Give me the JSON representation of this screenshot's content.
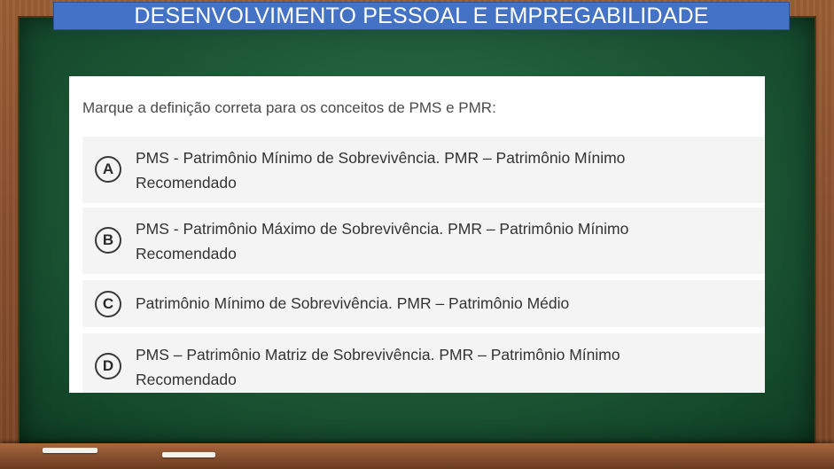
{
  "header": {
    "title": "DESENVOLVIMENTO PESSOAL E EMPREGABILIDADE"
  },
  "question": {
    "prompt": "Marque a definição correta para os conceitos de PMS e PMR:"
  },
  "options": [
    {
      "letter": "A",
      "text": "PMS - Patrimônio Mínimo de Sobrevivência. PMR – Patrimônio Mínimo Recomendado"
    },
    {
      "letter": "B",
      "text": "PMS - Patrimônio Máximo de Sobrevivência. PMR – Patrimônio Mínimo Recomendado"
    },
    {
      "letter": "C",
      "text": "Patrimônio Mínimo de Sobrevivência. PMR – Patrimônio Médio"
    },
    {
      "letter": "D",
      "text": "PMS – Patrimônio Matriz de Sobrevivência. PMR – Patrimônio Mínimo Recomendado"
    }
  ],
  "colors": {
    "title_bar": "#4472c4",
    "board": "#1f5a38",
    "frame": "#8b5230"
  }
}
